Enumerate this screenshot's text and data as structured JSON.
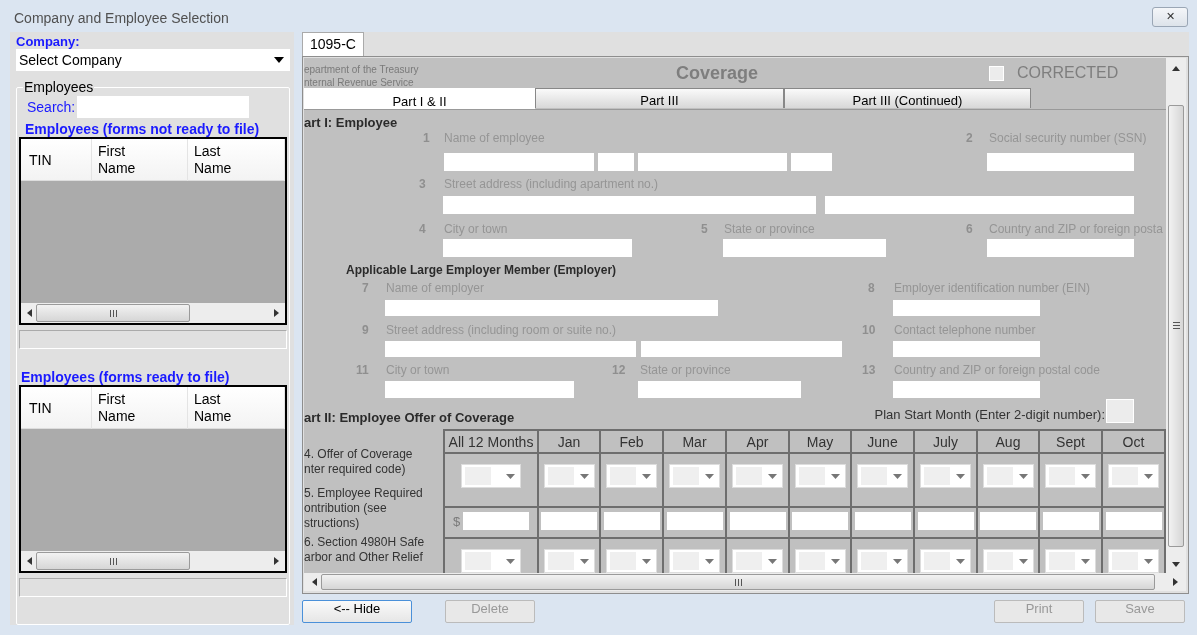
{
  "window": {
    "title": "Company and Employee Selection",
    "close": "✕"
  },
  "sidebar": {
    "company_label": "Company:",
    "company_select": "Select Company",
    "group_title": "Employees",
    "search_label": "Search:",
    "tables": [
      {
        "title": "Employees (forms not ready to file)",
        "columns": [
          "TIN",
          "First Name",
          "Last Name"
        ]
      },
      {
        "title": "Employees (forms ready to file)",
        "columns": [
          "TIN",
          "First Name",
          "Last Name"
        ]
      }
    ]
  },
  "doc_tabs": [
    {
      "label": "1095-C",
      "selected": true
    }
  ],
  "form": {
    "department": "epartment of the Treasury",
    "irs": "nternal Revenue Service",
    "title": "Coverage",
    "corrected": {
      "label": "CORRECTED",
      "checked": false
    },
    "part_tabs": [
      {
        "label": "Part I &  II",
        "selected": true
      },
      {
        "label": "Part III",
        "selected": false
      },
      {
        "label": "Part III (Continued)",
        "selected": false
      }
    ],
    "part1_heading": "art I: Employee",
    "employer_heading": "Applicable Large Employer Member (Employer)",
    "fields": [
      {
        "number": "1",
        "label": "Name of employee"
      },
      {
        "number": "2",
        "label": "Social security number (SSN)"
      },
      {
        "number": "3",
        "label": "Street address (including apartment no.)"
      },
      {
        "number": "4",
        "label": "City or town"
      },
      {
        "number": "5",
        "label": "State or province"
      },
      {
        "number": "6",
        "label": "Country and ZIP or foreign posta"
      },
      {
        "number": "7",
        "label": "Name of employer"
      },
      {
        "number": "8",
        "label": "Employer identification number (EIN)"
      },
      {
        "number": "9",
        "label": "Street address (including room or suite no.)"
      },
      {
        "number": "10",
        "label": "Contact telephone number"
      },
      {
        "number": "11",
        "label": "City or town"
      },
      {
        "number": "12",
        "label": "State or province"
      },
      {
        "number": "13",
        "label": "Country and ZIP or foreign postal code"
      }
    ],
    "part2_heading": "art II: Employee Offer of Coverage",
    "plan_start_label": "Plan Start Month (Enter 2-digit number):",
    "grid": {
      "columns": [
        "All 12 Months",
        "Jan",
        "Feb",
        "Mar",
        "Apr",
        "May",
        "June",
        "July",
        "Aug",
        "Sept",
        "Oct"
      ],
      "rows": [
        {
          "kind": "dropdown",
          "label_lines": [
            "4.  Offer of Coverage",
            "nter required code)"
          ]
        },
        {
          "kind": "amount",
          "currency": "$",
          "label_lines": [
            "5.  Employee Required",
            "ontribution (see",
            "structions)"
          ]
        },
        {
          "kind": "dropdown",
          "label_lines": [
            "6.  Section 4980H Safe",
            "arbor and Other Relief"
          ]
        }
      ]
    }
  },
  "buttons": [
    {
      "label": "<-- Hide",
      "disabled": false
    },
    {
      "label": "Delete",
      "disabled": true
    },
    {
      "label": "Print",
      "disabled": true
    },
    {
      "label": "Save",
      "disabled": true
    }
  ]
}
